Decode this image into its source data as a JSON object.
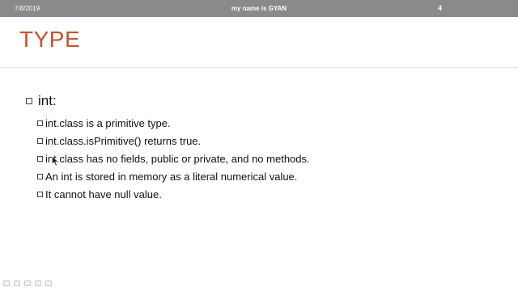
{
  "header": {
    "date": "7/8/2019",
    "footer_title": "my name is GYAN",
    "page_number": "4"
  },
  "slide": {
    "title": "TYPE",
    "bullet": "int:",
    "sub_bullets": [
      "int.class is a primitive type.",
      "int.class.isPrimitive() returns true.",
      "int.class has no fields, public or private, and no methods.",
      "An int is stored in memory as a literal numerical value.",
      "It cannot have null value."
    ]
  },
  "colors": {
    "title": "#c0562e",
    "header_bar": "#8a8a8a"
  },
  "toolbar": {
    "icons": [
      "previous-slide-icon",
      "next-slide-icon",
      "pen-icon",
      "slides-view-icon",
      "zoom-icon"
    ]
  }
}
